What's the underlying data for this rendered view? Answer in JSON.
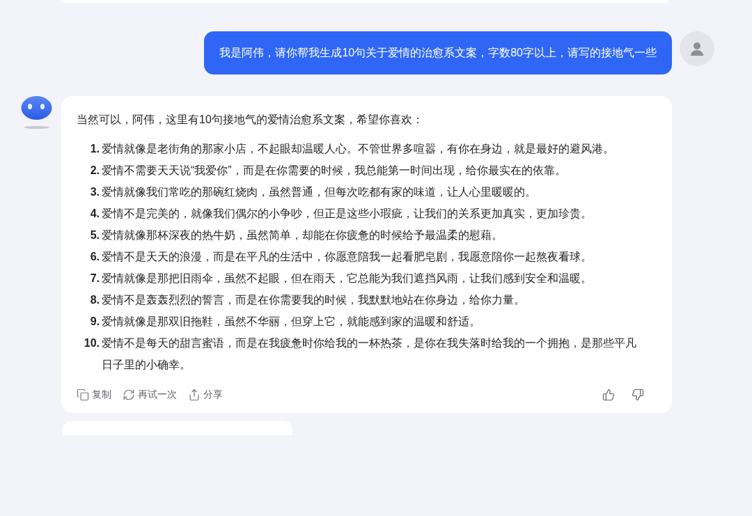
{
  "user_message": {
    "text": "我是阿伟，请你帮我生成10句关于爱情的治愈系文案，字数80字以上，请写的接地气一些"
  },
  "reply": {
    "intro": "当然可以，阿伟，这里有10句接地气的爱情治愈系文案，希望你喜欢：",
    "items": [
      {
        "number": "1.",
        "text": "爱情就像是老街角的那家小店，不起眼却温暖人心。不管世界多喧嚣，有你在身边，就是最好的避风港。"
      },
      {
        "number": "2.",
        "text": "爱情不需要天天说“我爱你”，而是在你需要的时候，我总能第一时间出现，给你最实在的依靠。"
      },
      {
        "number": "3.",
        "text": "爱情就像我们常吃的那碗红烧肉，虽然普通，但每次吃都有家的味道，让人心里暖暖的。"
      },
      {
        "number": "4.",
        "text": "爱情不是完美的，就像我们偶尔的小争吵，但正是这些小瑕疵，让我们的关系更加真实，更加珍贵。"
      },
      {
        "number": "5.",
        "text": "爱情就像那杯深夜的热牛奶，虽然简单，却能在你疲惫的时候给予最温柔的慰藉。"
      },
      {
        "number": "6.",
        "text": "爱情不是天天的浪漫，而是在平凡的生活中，你愿意陪我一起看肥皂剧，我愿意陪你一起熬夜看球。"
      },
      {
        "number": "7.",
        "text": "爱情就像是那把旧雨伞，虽然不起眼，但在雨天，它总能为我们遮挡风雨，让我们感到安全和温暖。"
      },
      {
        "number": "8.",
        "text": "爱情不是轰轰烈烈的誓言，而是在你需要我的时候，我默默地站在你身边，给你力量。"
      },
      {
        "number": "9.",
        "text": "爱情就像是那双旧拖鞋，虽然不华丽，但穿上它，就能感到家的温暖和舒适。"
      },
      {
        "number": "10.",
        "text": "爱情不是每天的甜言蜜语，而是在我疲惫时你给我的一杯热茶，是你在我失落时给我的一个拥抱，是那些平凡日子里的小确幸。"
      }
    ],
    "actions": [
      {
        "kind": "copy",
        "label": "复制"
      },
      {
        "kind": "retry",
        "label": "再试一次"
      },
      {
        "kind": "share",
        "label": "分享"
      },
      {
        "kind": "like"
      },
      {
        "kind": "dislike"
      }
    ]
  }
}
